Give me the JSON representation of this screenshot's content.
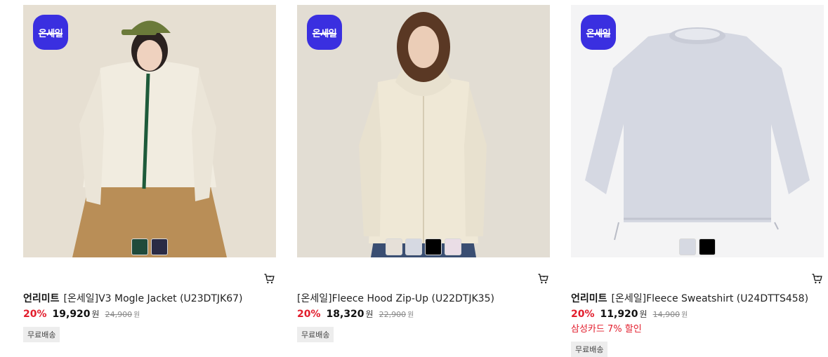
{
  "badge_text": "온세일",
  "products": [
    {
      "brand": "언리미트",
      "name": "[온세일]V3 Mogle Jacket (U23DTJK67)",
      "discount": "20%",
      "price": "19,920",
      "currency": "원",
      "original_price": "24,900",
      "original_currency": "원",
      "card_promo": "",
      "tag": "무료배송",
      "swatch_colors": [
        "#1f4a3b",
        "#2a2b45"
      ]
    },
    {
      "brand": "",
      "name": "[온세일]Fleece Hood Zip-Up (U22DTJK35)",
      "discount": "20%",
      "price": "18,320",
      "currency": "원",
      "original_price": "22,900",
      "original_currency": "원",
      "card_promo": "",
      "tag": "무료배송",
      "swatch_colors": [
        "#e6e0d8",
        "#d6d9e2",
        "#000000",
        "#eadde6"
      ]
    },
    {
      "brand": "언리미트",
      "name": "[온세일]Fleece Sweatshirt (U24DTTS458)",
      "discount": "20%",
      "price": "11,920",
      "currency": "원",
      "original_price": "14,900",
      "original_currency": "원",
      "card_promo": "삼성카드 7% 할인",
      "tag": "무료배송",
      "swatch_colors": [
        "#d6d9e2",
        "#000000"
      ]
    }
  ],
  "colors": {
    "badge": "#3a2fe0",
    "discount": "#e21d2c"
  }
}
